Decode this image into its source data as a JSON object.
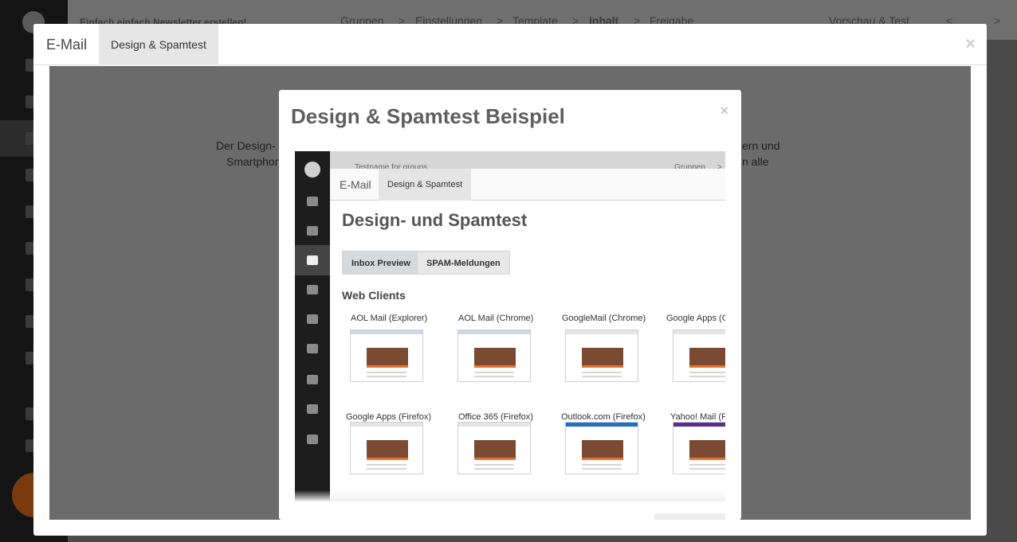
{
  "background": {
    "top_title": "Einfach einfach Newsletter erstellen!",
    "breadcrumb": [
      "Gruppen",
      "Einstellungen",
      "Template",
      "Inhalt",
      "Freigabe"
    ],
    "breadcrumb_sep": ">",
    "preview_link": "Vorschau & Test",
    "nav_prev": "<",
    "nav_next": ">",
    "body_text_left_1": "Der Design-",
    "body_text_left_2": "Smartphon",
    "body_text_right_1": "ern und",
    "body_text_right_2": "n alle"
  },
  "outer_modal": {
    "tabs": [
      "E-Mail",
      "Design & Spamtest"
    ],
    "close": "×"
  },
  "inner_modal": {
    "title": "Design & Spamtest Beispiel",
    "close": "×"
  },
  "preview": {
    "top_left": "Testname for groups",
    "top_right": "Gruppen",
    "top_sep": ">",
    "tabs": [
      "E-Mail",
      "Design & Spamtest"
    ],
    "heading": "Design- und Spamtest",
    "buttons": [
      "Inbox Preview",
      "SPAM-Meldungen"
    ],
    "section": "Web Clients",
    "clients": [
      "AOL Mail (Explorer)",
      "AOL Mail (Chrome)",
      "GoogleMail (Chrome)",
      "Google Apps (C",
      "Google Apps (Firefox)",
      "Office 365 (Firefox)",
      "Outlook.com (Firefox)",
      "Yahoo! Mail (Fi"
    ]
  },
  "colors": {
    "accent_orange": "#e8742a",
    "dark_sidebar": "#1d1d1d",
    "title_gray": "#5f5f5f"
  }
}
